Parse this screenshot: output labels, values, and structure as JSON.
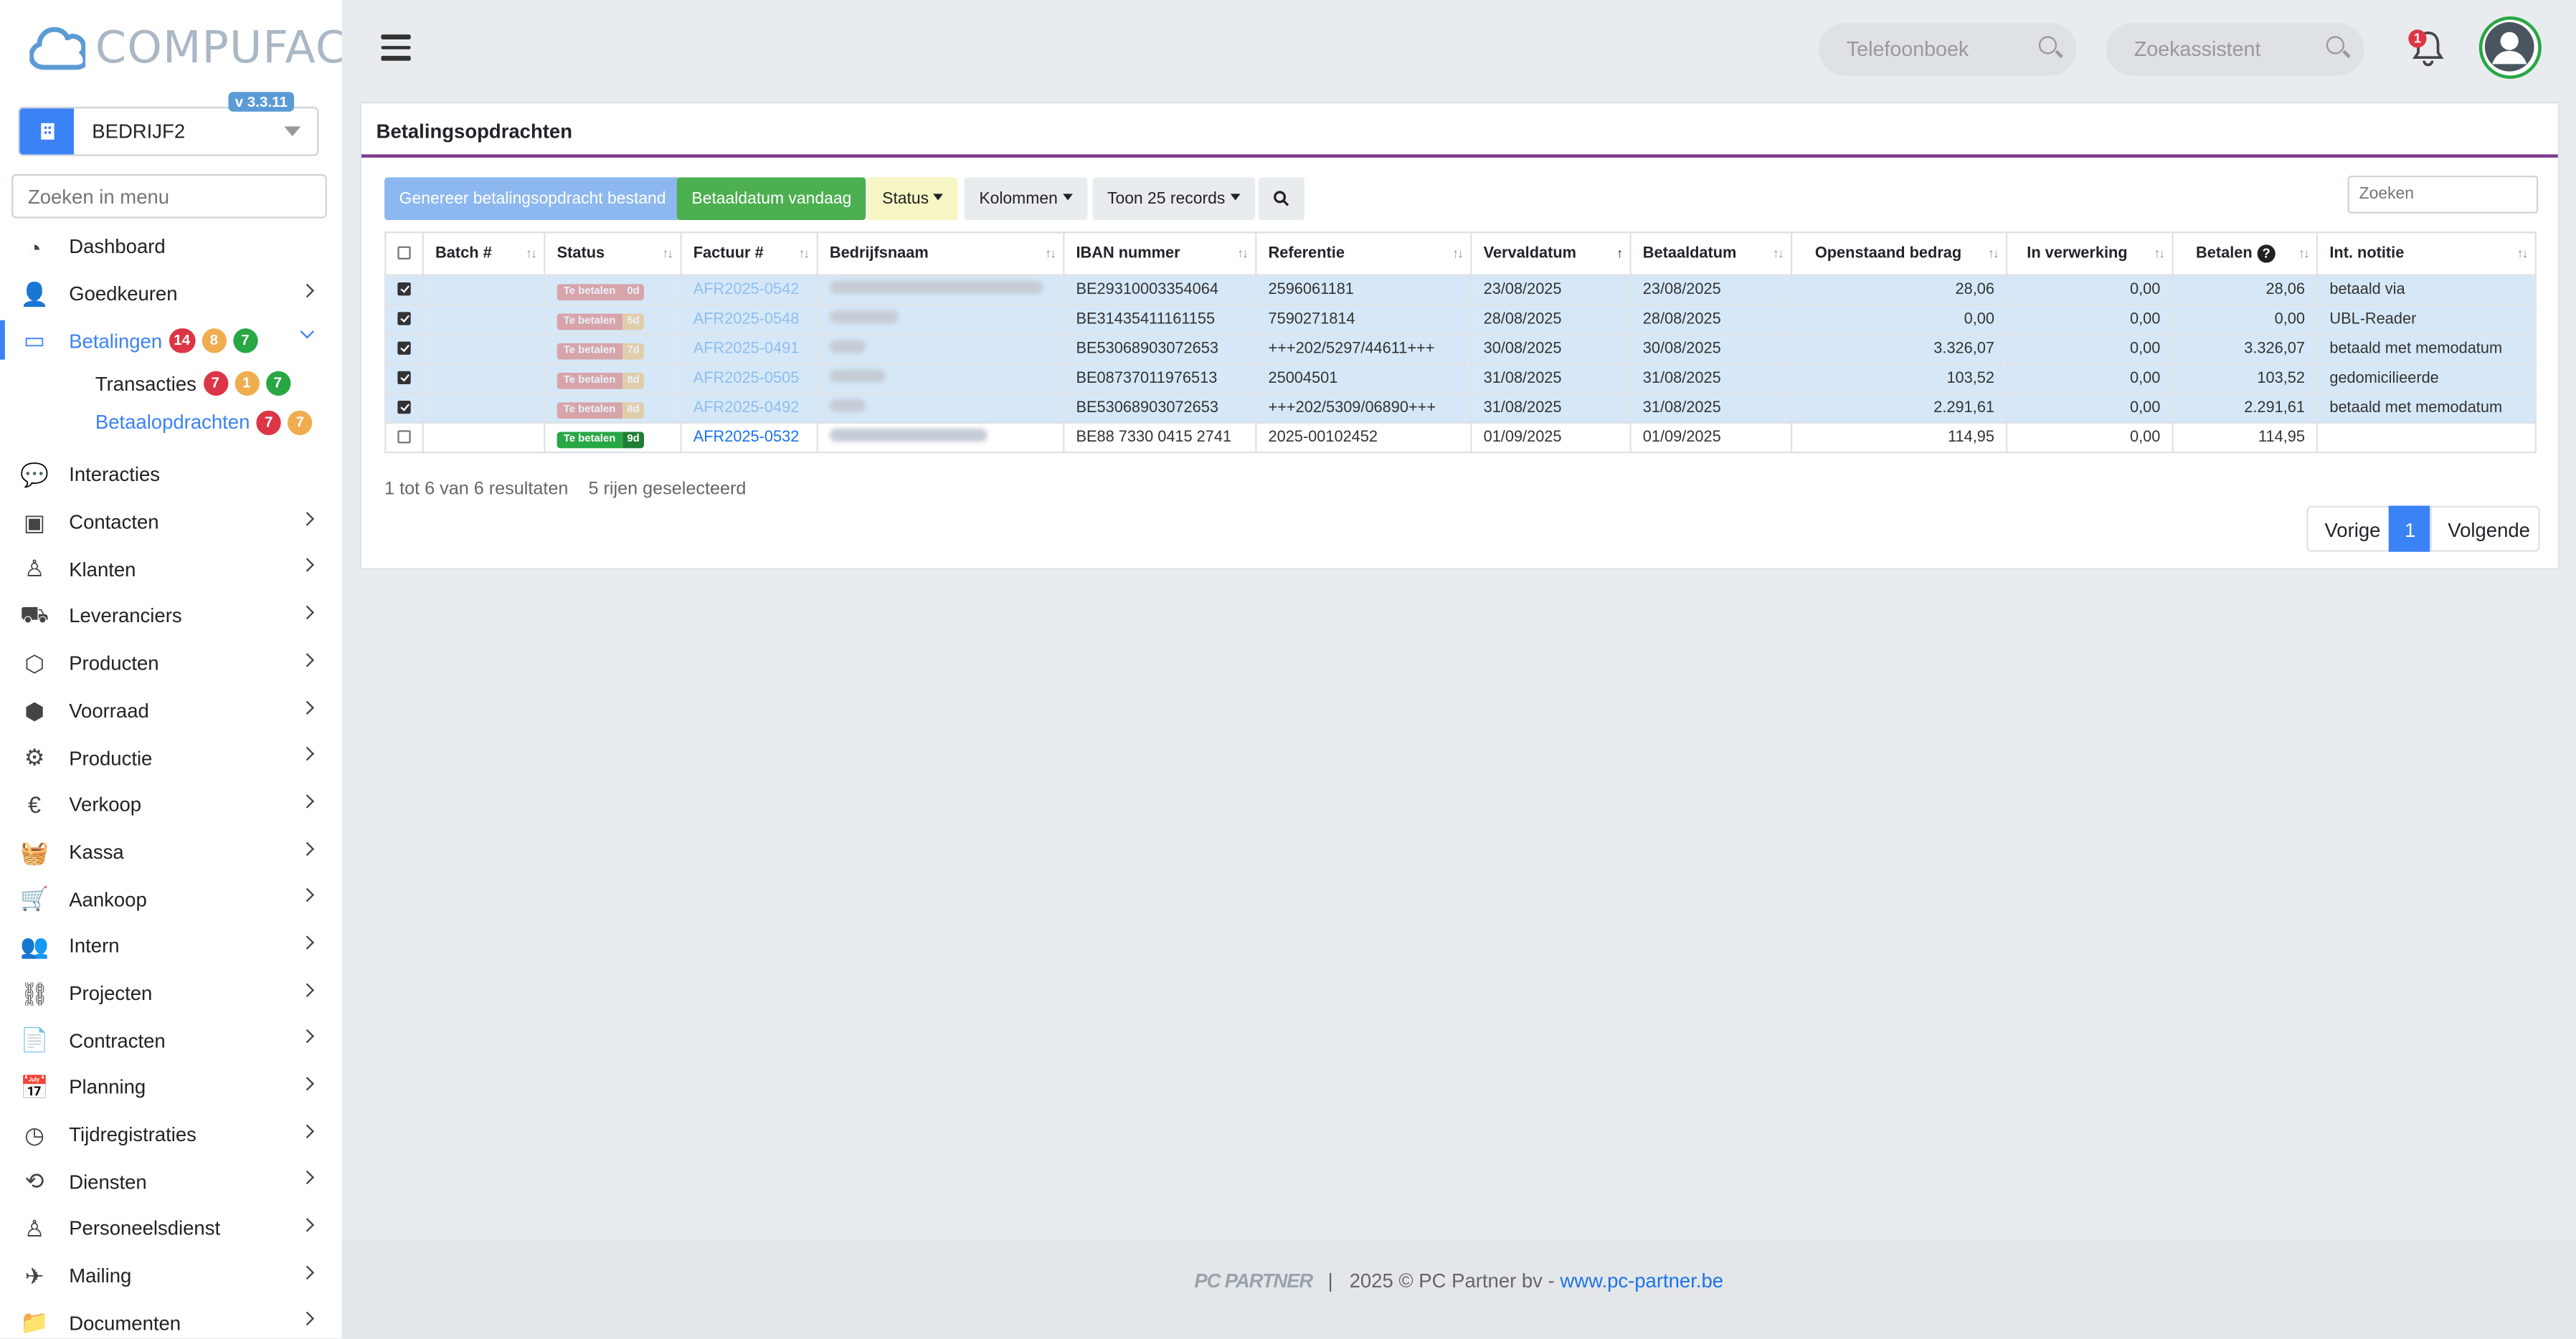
{
  "app": {
    "logo_text": "COMPUFACT",
    "version": "v 3.3.11",
    "company": "BEDRIJF2",
    "menu_search_placeholder": "Zoeken in menu"
  },
  "sidebar": {
    "items": [
      {
        "label": "Dashboard",
        "icon": "dashboard-icon"
      },
      {
        "label": "Goedkeuren",
        "icon": "user-check-icon"
      },
      {
        "label": "Betalingen",
        "icon": "credit-card-icon",
        "badges": [
          "14",
          "8",
          "7"
        ]
      },
      {
        "label": "Transacties",
        "badges": [
          "7",
          "1",
          "7"
        ]
      },
      {
        "label": "Betaalopdrachten",
        "badges": [
          "7",
          "7"
        ]
      },
      {
        "label": "Interacties",
        "icon": "chat-icon"
      },
      {
        "label": "Contacten",
        "icon": "contact-card-icon"
      },
      {
        "label": "Klanten",
        "icon": "customer-icon"
      },
      {
        "label": "Leveranciers",
        "icon": "truck-icon"
      },
      {
        "label": "Producten",
        "icon": "box-icon"
      },
      {
        "label": "Voorraad",
        "icon": "boxes-icon"
      },
      {
        "label": "Productie",
        "icon": "gears-icon"
      },
      {
        "label": "Verkoop",
        "icon": "euro-icon"
      },
      {
        "label": "Kassa",
        "icon": "basket-icon"
      },
      {
        "label": "Aankoop",
        "icon": "cart-icon"
      },
      {
        "label": "Intern",
        "icon": "users-icon"
      },
      {
        "label": "Projecten",
        "icon": "project-nodes-icon"
      },
      {
        "label": "Contracten",
        "icon": "contract-icon"
      },
      {
        "label": "Planning",
        "icon": "calendar-icon"
      },
      {
        "label": "Tijdregistraties",
        "icon": "clock-icon"
      },
      {
        "label": "Diensten",
        "icon": "repeat-icon"
      },
      {
        "label": "Personeelsdienst",
        "icon": "staff-icon"
      },
      {
        "label": "Mailing",
        "icon": "paper-plane-icon"
      },
      {
        "label": "Documenten",
        "icon": "folder-icon"
      }
    ]
  },
  "header": {
    "phonebook_placeholder": "Telefoonboek",
    "assistant_placeholder": "Zoekassistent",
    "notification_count": "1"
  },
  "page": {
    "title": "Betalingsopdrachten",
    "buttons": {
      "generate": "Genereer betalingsopdracht bestand",
      "today": "Betaaldatum vandaag",
      "status": "Status",
      "columns": "Kolommen",
      "show": "Toon 25 records"
    },
    "search_placeholder": "Zoeken",
    "columns": [
      "Batch #",
      "Status",
      "Factuur #",
      "Bedrijfsnaam",
      "IBAN nummer",
      "Referentie",
      "Vervaldatum",
      "Betaaldatum",
      "Openstaand bedrag",
      "In verwerking",
      "Betalen",
      "Int. notitie"
    ],
    "rows": [
      {
        "status": "Te betalen",
        "days": "0d",
        "invoice": "AFR2025-0542",
        "iban": "BE29310003354064",
        "ref": "2596061181",
        "due": "23/08/2025",
        "paydate": "23/08/2025",
        "open": "28,06",
        "processing": "0,00",
        "pay": "28,06",
        "note": "betaald via"
      },
      {
        "status": "Te betalen",
        "days": "5d",
        "invoice": "AFR2025-0548",
        "iban": "BE31435411161155",
        "ref": "7590271814",
        "due": "28/08/2025",
        "paydate": "28/08/2025",
        "open": "0,00",
        "processing": "0,00",
        "pay": "0,00",
        "note": "UBL-Reader"
      },
      {
        "status": "Te betalen",
        "days": "7d",
        "invoice": "AFR2025-0491",
        "iban": "BE53068903072653",
        "ref": "+++202/5297/44611+++",
        "due": "30/08/2025",
        "paydate": "30/08/2025",
        "open": "3.326,07",
        "processing": "0,00",
        "pay": "3.326,07",
        "note": "betaald met memodatum"
      },
      {
        "status": "Te betalen",
        "days": "8d",
        "invoice": "AFR2025-0505",
        "iban": "BE08737011976513",
        "ref": "25004501",
        "due": "31/08/2025",
        "paydate": "31/08/2025",
        "open": "103,52",
        "processing": "0,00",
        "pay": "103,52",
        "note": "gedomicilieerde"
      },
      {
        "status": "Te betalen",
        "days": "8d",
        "invoice": "AFR2025-0492",
        "iban": "BE53068903072653",
        "ref": "+++202/5309/06890+++",
        "due": "31/08/2025",
        "paydate": "31/08/2025",
        "open": "2.291,61",
        "processing": "0,00",
        "pay": "2.291,61",
        "note": "betaald met memodatum"
      },
      {
        "status": "Te betalen",
        "days": "9d",
        "invoice": "AFR2025-0532",
        "iban": "BE88 7330 0415 2741",
        "ref": "2025-00102452",
        "due": "01/09/2025",
        "paydate": "01/09/2025",
        "open": "114,95",
        "processing": "0,00",
        "pay": "114,95",
        "note": ""
      }
    ],
    "summary": "1 tot 6 van 6 resultaten",
    "selected": "5 rijen geselecteerd",
    "pager": {
      "prev": "Vorige",
      "current": "1",
      "next": "Volgende"
    }
  },
  "footer": {
    "logo": "PC PARTNER",
    "separator": "|",
    "text": "2025 © PC Partner bv -",
    "link": "www.pc-partner.be"
  },
  "colors": {
    "accent": "#3b82f6",
    "title_rule": "#7d3c8c",
    "selected_row": "#d6e8f7",
    "badge_red": "#dc3545",
    "badge_yellow": "#f0ad4e",
    "badge_green": "#28a745"
  }
}
